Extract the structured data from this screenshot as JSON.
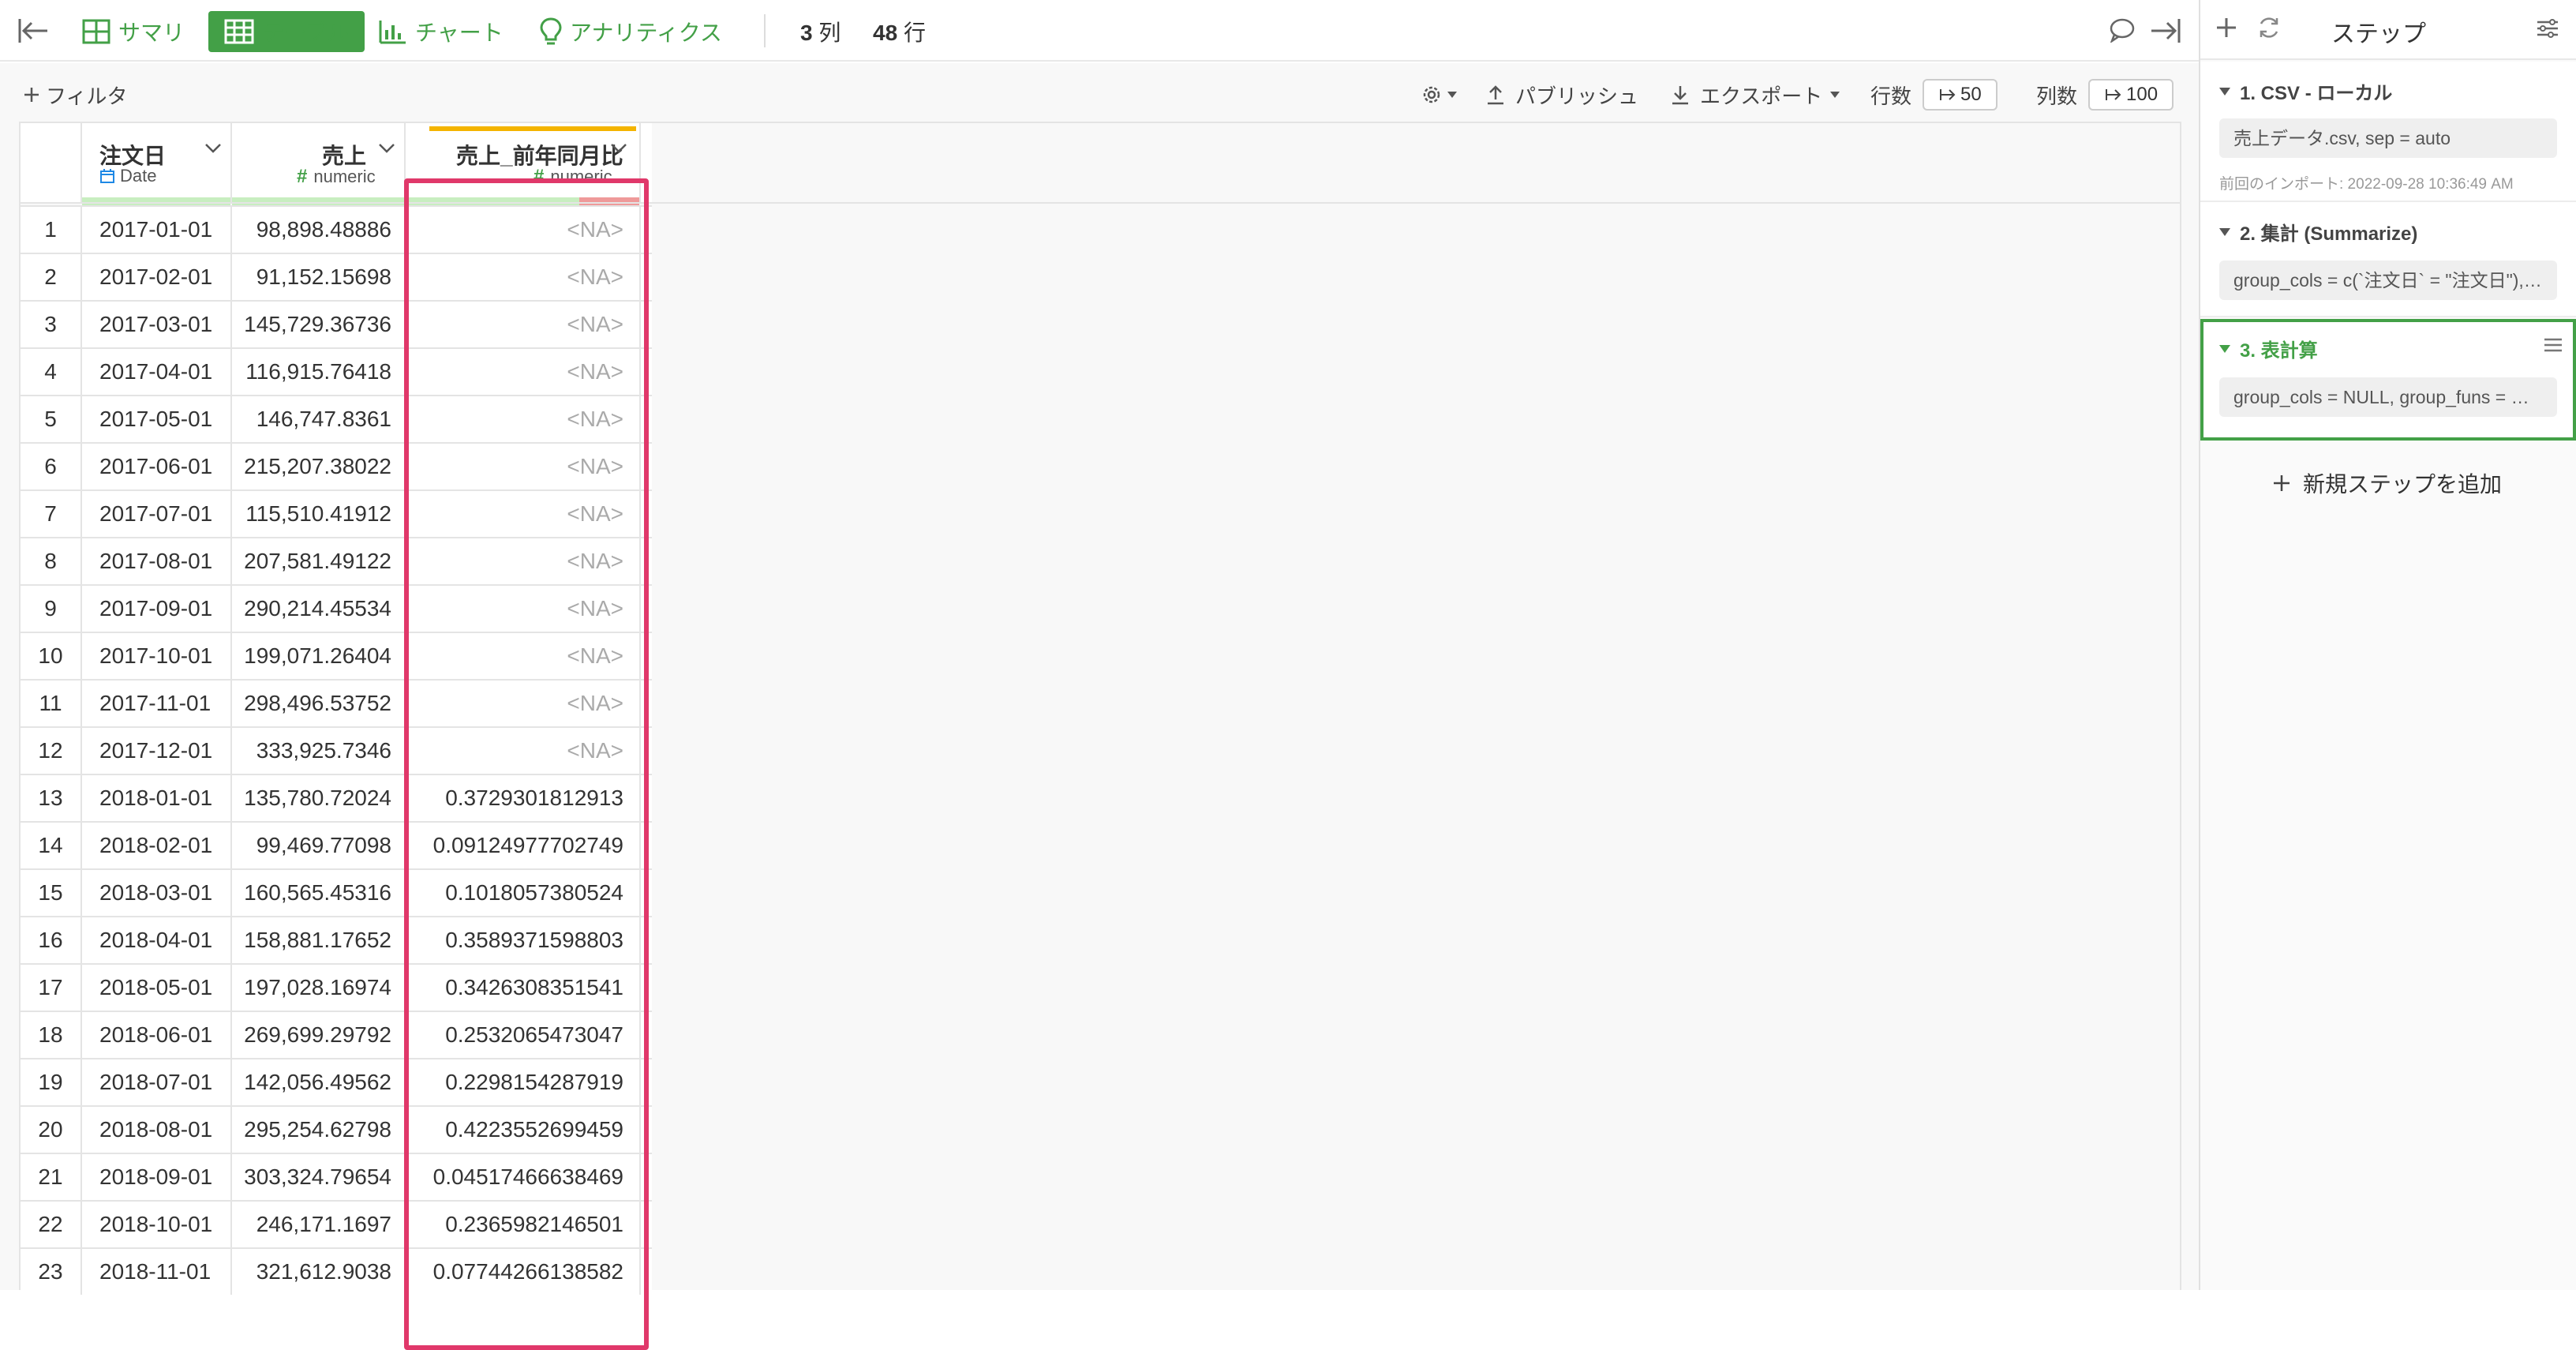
{
  "toolbar": {
    "tabs": [
      {
        "label": "サマリ",
        "icon": "summary-grid-icon"
      },
      {
        "label": "テーブル",
        "icon": "table-icon"
      },
      {
        "label": "チャート",
        "icon": "bar-chart-icon"
      },
      {
        "label": "アナリティクス",
        "icon": "lightbulb-icon"
      }
    ],
    "columns_count": "3",
    "columns_unit": "列",
    "rows_count": "48",
    "rows_unit": "行"
  },
  "filterbar": {
    "filter_label": "フィルタ",
    "publish_label": "パブリッシュ",
    "export_label": "エクスポート",
    "rows_label": "行数",
    "rows_value": "50",
    "cols_label": "列数",
    "cols_value": "100"
  },
  "table": {
    "columns": [
      {
        "name": "注文日",
        "type": "Date"
      },
      {
        "name": "売上",
        "type": "numeric"
      },
      {
        "name": "売上_前年同月比",
        "type": "numeric"
      }
    ],
    "rows": [
      [
        "1",
        "2017-01-01",
        "98,898.48886",
        "<NA>"
      ],
      [
        "2",
        "2017-02-01",
        "91,152.15698",
        "<NA>"
      ],
      [
        "3",
        "2017-03-01",
        "145,729.36736",
        "<NA>"
      ],
      [
        "4",
        "2017-04-01",
        "116,915.76418",
        "<NA>"
      ],
      [
        "5",
        "2017-05-01",
        "146,747.8361",
        "<NA>"
      ],
      [
        "6",
        "2017-06-01",
        "215,207.38022",
        "<NA>"
      ],
      [
        "7",
        "2017-07-01",
        "115,510.41912",
        "<NA>"
      ],
      [
        "8",
        "2017-08-01",
        "207,581.49122",
        "<NA>"
      ],
      [
        "9",
        "2017-09-01",
        "290,214.45534",
        "<NA>"
      ],
      [
        "10",
        "2017-10-01",
        "199,071.26404",
        "<NA>"
      ],
      [
        "11",
        "2017-11-01",
        "298,496.53752",
        "<NA>"
      ],
      [
        "12",
        "2017-12-01",
        "333,925.7346",
        "<NA>"
      ],
      [
        "13",
        "2018-01-01",
        "135,780.72024",
        "0.3729301812913"
      ],
      [
        "14",
        "2018-02-01",
        "99,469.77098",
        "0.09124977702749"
      ],
      [
        "15",
        "2018-03-01",
        "160,565.45316",
        "0.1018057380524"
      ],
      [
        "16",
        "2018-04-01",
        "158,881.17652",
        "0.3589371598803"
      ],
      [
        "17",
        "2018-05-01",
        "197,028.16974",
        "0.3426308351541"
      ],
      [
        "18",
        "2018-06-01",
        "269,699.29792",
        "0.2532065473047"
      ],
      [
        "19",
        "2018-07-01",
        "142,056.49562",
        "0.2298154287919"
      ],
      [
        "20",
        "2018-08-01",
        "295,254.62798",
        "0.4223552699459"
      ],
      [
        "21",
        "2018-09-01",
        "303,324.79654",
        "0.04517466638469"
      ],
      [
        "22",
        "2018-10-01",
        "246,171.1697",
        "0.2365982146501"
      ],
      [
        "23",
        "2018-11-01",
        "321,612.9038",
        "0.07744266138582"
      ]
    ]
  },
  "sidebar": {
    "title": "ステップ",
    "steps": [
      {
        "title": "1. CSV - ローカル",
        "command": "売上データ.csv, sep = auto",
        "meta": "前回のインポート: 2022-09-28 10:36:49 AM"
      },
      {
        "title": "2. 集計 (Summarize)",
        "command": "group_cols = c(`注文日` = \"注文日\"),…"
      },
      {
        "title": "3. 表計算",
        "command": "group_cols = NULL, group_funs = …"
      }
    ],
    "add_step_label": "新規ステップを追加"
  },
  "colors": {
    "accent": "#43a047",
    "highlight": "#e0386a",
    "type_bar_green": "#c8eec0",
    "type_bar_red": "#ef9a9a",
    "type_bar_orange": "#f4b400"
  }
}
